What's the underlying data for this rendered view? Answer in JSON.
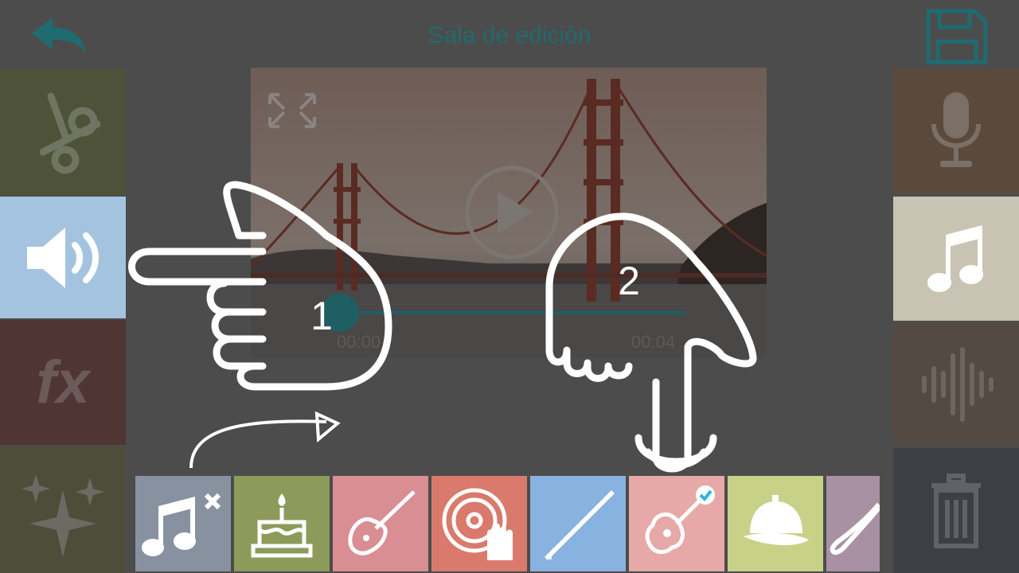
{
  "header": {
    "title": "Sala de edición",
    "back_icon": "undo-arrow-icon",
    "save_icon": "floppy-disk-icon"
  },
  "left_tools": [
    {
      "name": "scissors-icon",
      "color": "#4d5238"
    },
    {
      "name": "speaker-icon",
      "color": "#a4c3df",
      "active": true
    },
    {
      "name": "fx-icon",
      "label": "fx",
      "color": "#4f3634"
    },
    {
      "name": "sparkles-icon",
      "color": "#4d4d3a"
    }
  ],
  "right_tools": [
    {
      "name": "microphone-icon",
      "color": "#5b4a3b"
    },
    {
      "name": "music-note-icon",
      "color": "#c9c3b3",
      "active": true
    },
    {
      "name": "sound-wave-icon",
      "color": "#544a44"
    },
    {
      "name": "trash-icon",
      "color": "#3c3f45"
    }
  ],
  "player": {
    "time_start": "00:00",
    "time_end": "00:04",
    "progress": 0.0
  },
  "music_tracks": [
    {
      "name": "no-music-icon",
      "color": "#8891a0"
    },
    {
      "name": "birthday-cake-icon",
      "color": "#8e9a5a"
    },
    {
      "name": "electric-guitar-icon",
      "color": "#d98e93"
    },
    {
      "name": "dj-turntable-icon",
      "color": "#d97a6c"
    },
    {
      "name": "clarinet-icon",
      "color": "#88b2df"
    },
    {
      "name": "acoustic-guitar-icon",
      "color": "#e6a9a8",
      "selected": true
    },
    {
      "name": "cap-icon",
      "color": "#c8d188"
    },
    {
      "name": "saxophone-icon",
      "color": "#a791a3"
    }
  ],
  "tutorial": {
    "step1_label": "1",
    "step2_label": "2"
  }
}
